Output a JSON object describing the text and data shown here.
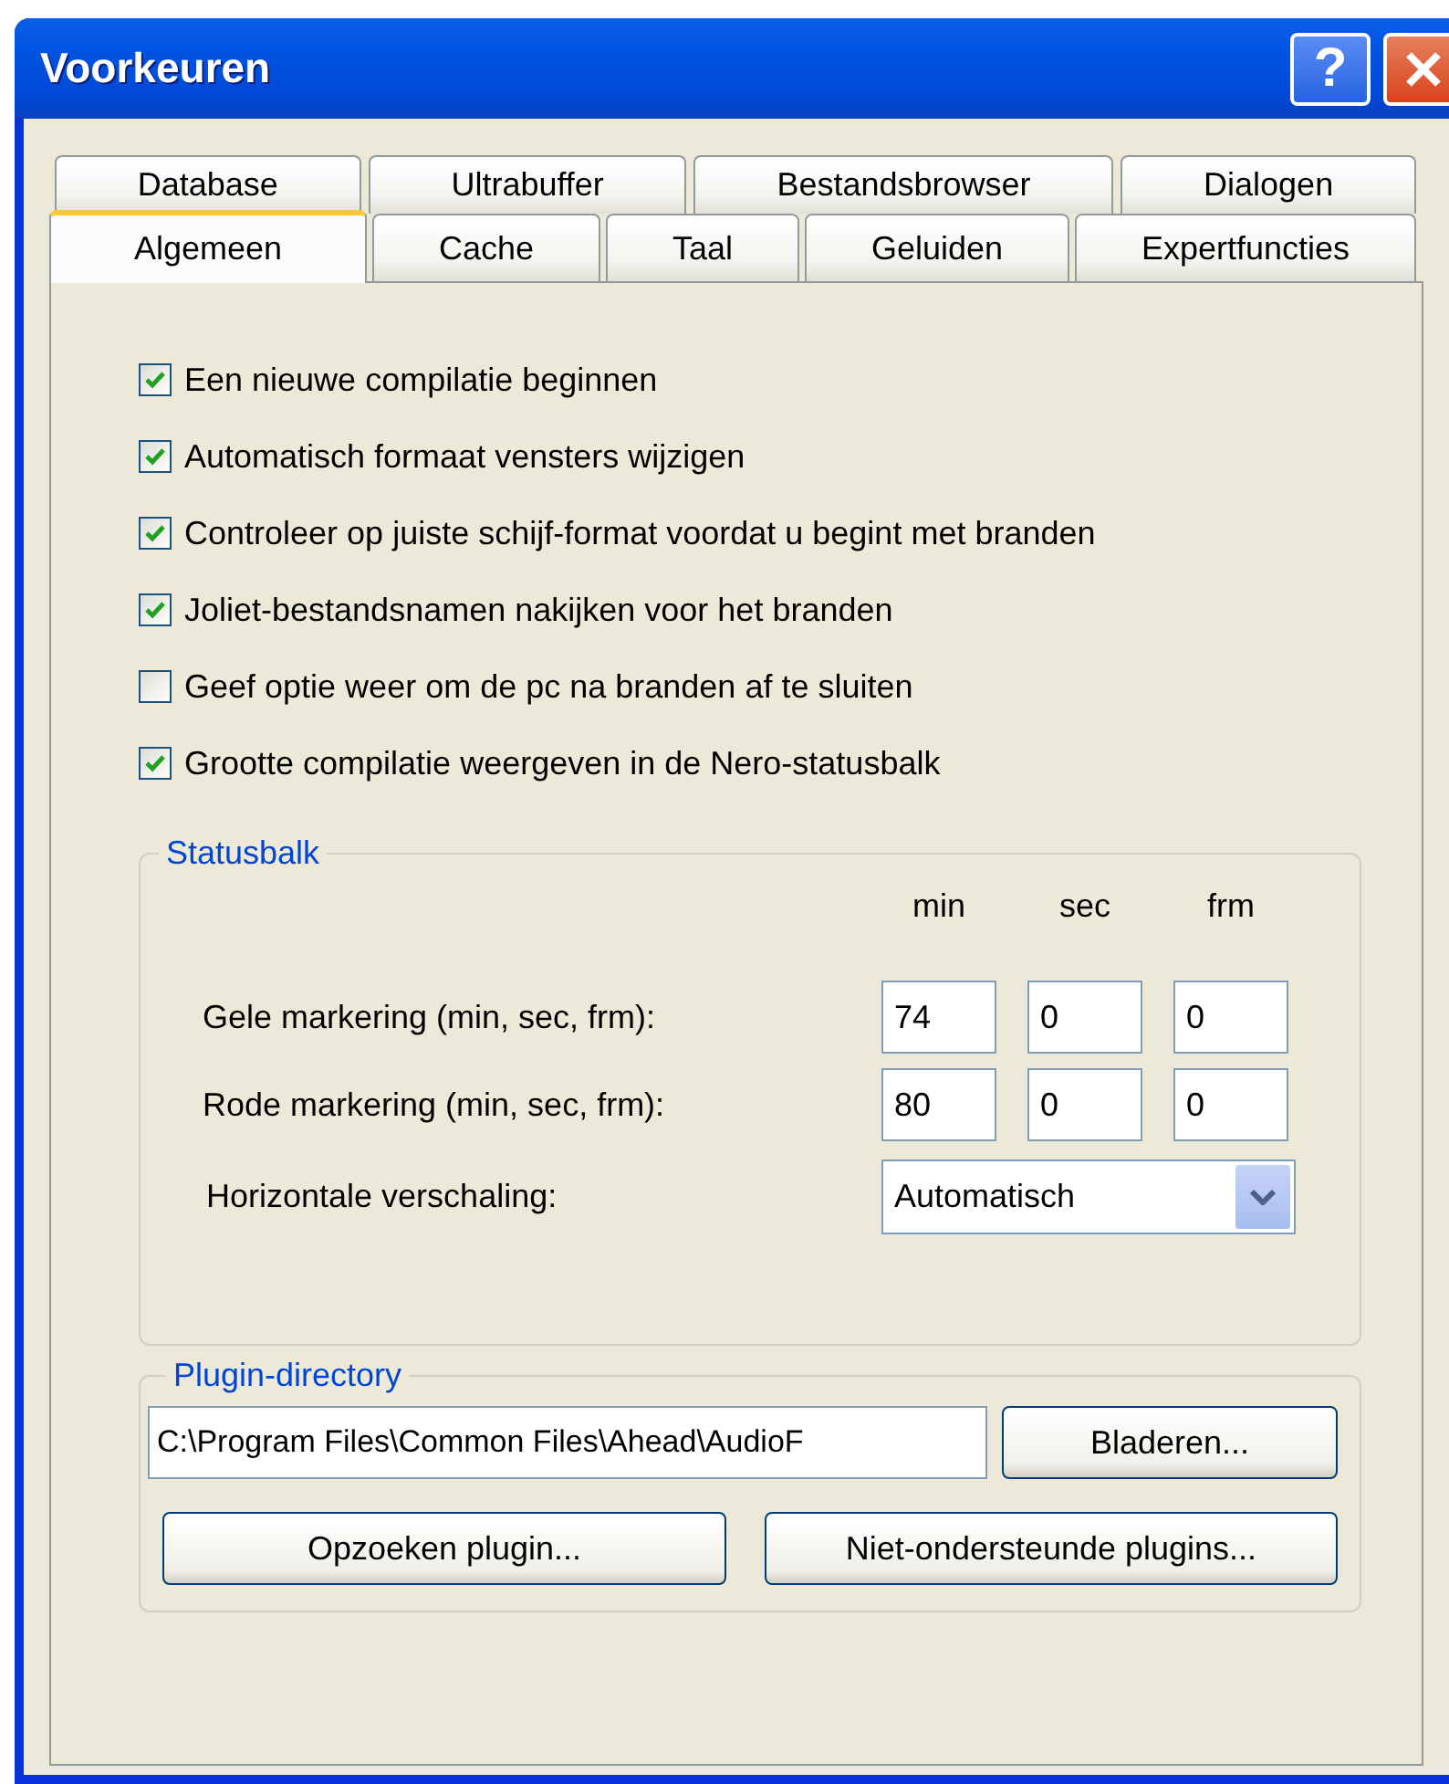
{
  "window": {
    "title": "Voorkeuren",
    "help_button": "?"
  },
  "tab_rows": [
    {
      "tabs": [
        {
          "label": "Database",
          "selected": false
        },
        {
          "label": "Ultrabuffer",
          "selected": false
        },
        {
          "label": "Bestandsbrowser",
          "selected": false
        },
        {
          "label": "Dialogen",
          "selected": false
        }
      ]
    },
    {
      "tabs": [
        {
          "label": "Algemeen",
          "selected": true
        },
        {
          "label": "Cache",
          "selected": false
        },
        {
          "label": "Taal",
          "selected": false
        },
        {
          "label": "Geluiden",
          "selected": false
        },
        {
          "label": "Expertfuncties",
          "selected": false
        }
      ]
    }
  ],
  "options": [
    {
      "label": "Een nieuwe compilatie beginnen",
      "checked": true
    },
    {
      "label": "Automatisch formaat vensters wijzigen",
      "checked": true
    },
    {
      "label": "Controleer op juiste schijf-format voordat u begint met branden",
      "checked": true
    },
    {
      "label": "Joliet-bestandsnamen nakijken voor het branden",
      "checked": true
    },
    {
      "label": "Geef optie weer om de pc na branden af te sluiten",
      "checked": false
    },
    {
      "label": "Grootte compilatie weergeven in de Nero-statusbalk",
      "checked": true
    }
  ],
  "statusbar_group": {
    "title": "Statusbalk",
    "columns": [
      "min",
      "sec",
      "frm"
    ],
    "rows": [
      {
        "label": "Gele markering (min, sec, frm):",
        "values": [
          "74",
          "0",
          "0"
        ]
      },
      {
        "label": "Rode markering (min, sec, frm):",
        "values": [
          "80",
          "0",
          "0"
        ]
      }
    ],
    "scaling": {
      "label": "Horizontale verschaling:",
      "value": "Automatisch"
    }
  },
  "plugin_group": {
    "title": "Plugin-directory",
    "path": "C:\\Program Files\\Common Files\\Ahead\\AudioF",
    "browse_button": "Bladeren...",
    "buttons": [
      "Opzoeken plugin...",
      "Niet-ondersteunde plugins..."
    ]
  }
}
